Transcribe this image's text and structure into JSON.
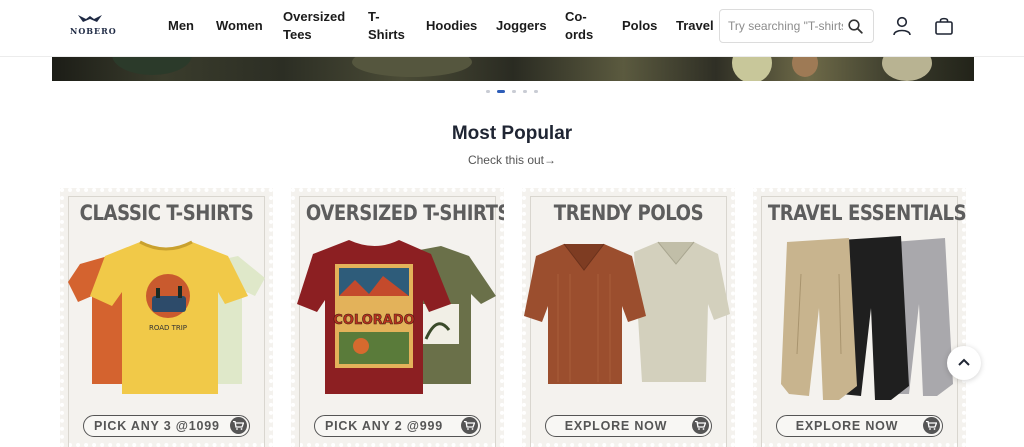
{
  "brand": {
    "name": "NOBERO"
  },
  "nav": {
    "items": [
      {
        "label": "Men"
      },
      {
        "label": "Women"
      },
      {
        "label": "Oversized Tees"
      },
      {
        "label": "T-Shirts"
      },
      {
        "label": "Hoodies"
      },
      {
        "label": "Joggers"
      },
      {
        "label": "Co-ords"
      },
      {
        "label": "Polos"
      },
      {
        "label": "Travel"
      }
    ]
  },
  "search": {
    "placeholder": "Try searching \"T-shirts\"",
    "value": ""
  },
  "icons": {
    "search": "search-icon",
    "user": "user-icon",
    "bag": "shopping-bag-icon",
    "cart": "cart-icon",
    "scroll_top": "chevron-up-icon"
  },
  "carousel": {
    "total": 5,
    "active": 1
  },
  "section": {
    "title": "Most Popular",
    "subtitle": "Check this out→"
  },
  "cards": [
    {
      "title": "CLASSIC T-SHIRTS",
      "cta": "PICK ANY 3 @1099"
    },
    {
      "title": "OVERSIZED T-SHIRTS",
      "cta": "PICK ANY 2 @999",
      "print_text": "COLORADO"
    },
    {
      "title": "TRENDY POLOS",
      "cta": "EXPLORE NOW"
    },
    {
      "title": "TRAVEL ESSENTIALS",
      "cta": "EXPLORE NOW"
    }
  ],
  "colors": {
    "accent": "#2d5db8",
    "text": "#1b1b1b",
    "card_bg": "#f4f2ee",
    "cta_text": "#555555"
  }
}
